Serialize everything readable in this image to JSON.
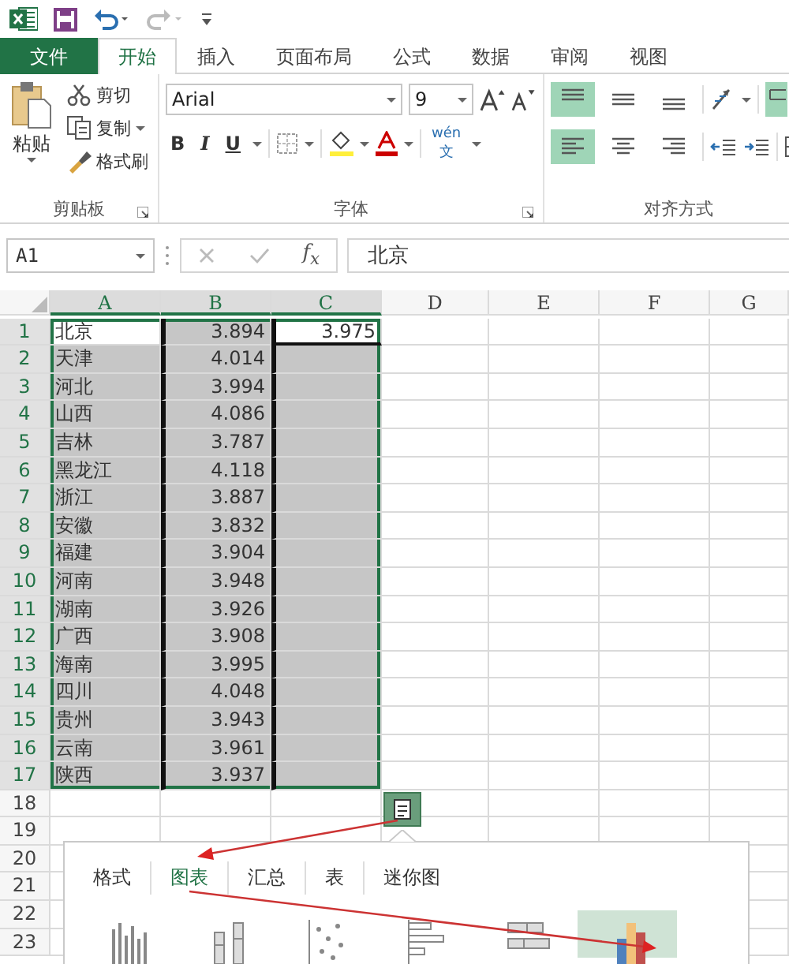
{
  "ribbon_tabs": [
    {
      "label": "文件",
      "kind": "file",
      "selected": false
    },
    {
      "label": "开始",
      "kind": "tab",
      "selected": true
    },
    {
      "label": "插入",
      "kind": "tab",
      "selected": false
    },
    {
      "label": "页面布局",
      "kind": "tab",
      "selected": false
    },
    {
      "label": "公式",
      "kind": "tab",
      "selected": false
    },
    {
      "label": "数据",
      "kind": "tab",
      "selected": false
    },
    {
      "label": "审阅",
      "kind": "tab",
      "selected": false
    },
    {
      "label": "视图",
      "kind": "tab",
      "selected": false
    }
  ],
  "clipboard": {
    "paste": "粘贴",
    "cut": "剪切",
    "copy": "复制",
    "format_painter": "格式刷",
    "group_label": "剪贴板"
  },
  "font": {
    "font_name": "Arial",
    "font_size": "9",
    "bold": "B",
    "italic": "I",
    "underline": "U",
    "phonetic": "wén",
    "phonetic_char": "文",
    "group_label": "字体"
  },
  "alignment": {
    "group_label": "对齐方式",
    "buttons": [
      {
        "kind": "top",
        "selected": true
      },
      {
        "kind": "middle",
        "selected": false
      },
      {
        "kind": "bottom",
        "selected": false
      },
      {
        "kind": "left",
        "selected": true
      },
      {
        "kind": "center",
        "selected": false
      },
      {
        "kind": "right",
        "selected": false
      }
    ]
  },
  "formula_bar": {
    "name_box": "A1",
    "fx": "f$_{x}$",
    "formula": "北京"
  },
  "columns": [
    {
      "label": "A",
      "selected": true
    },
    {
      "label": "B",
      "selected": true
    },
    {
      "label": "C",
      "selected": true
    },
    {
      "label": "D",
      "selected": false
    },
    {
      "label": "E",
      "selected": false
    },
    {
      "label": "F",
      "selected": false
    },
    {
      "label": "G",
      "selected": false
    }
  ],
  "rows": [
    {
      "number": "1",
      "selected": true,
      "cells": [
        "北京",
        "3.894",
        "3.975"
      ]
    },
    {
      "number": "2",
      "selected": true,
      "cells": [
        "天津",
        "4.014"
      ]
    },
    {
      "number": "3",
      "selected": true,
      "cells": [
        "河北",
        "3.994"
      ]
    },
    {
      "number": "4",
      "selected": true,
      "cells": [
        "山西",
        "4.086"
      ]
    },
    {
      "number": "5",
      "selected": true,
      "cells": [
        "吉林",
        "3.787"
      ]
    },
    {
      "number": "6",
      "selected": true,
      "cells": [
        "黑龙江",
        "4.118"
      ]
    },
    {
      "number": "7",
      "selected": true,
      "cells": [
        "浙江",
        "3.887"
      ]
    },
    {
      "number": "8",
      "selected": true,
      "cells": [
        "安徽",
        "3.832"
      ]
    },
    {
      "number": "9",
      "selected": true,
      "cells": [
        "福建",
        "3.904"
      ]
    },
    {
      "number": "10",
      "selected": true,
      "cells": [
        "河南",
        "3.948"
      ]
    },
    {
      "number": "11",
      "selected": true,
      "cells": [
        "湖南",
        "3.926"
      ]
    },
    {
      "number": "12",
      "selected": true,
      "cells": [
        "广西",
        "3.908"
      ]
    },
    {
      "number": "13",
      "selected": true,
      "cells": [
        "海南",
        "3.995"
      ]
    },
    {
      "number": "14",
      "selected": true,
      "cells": [
        "四川",
        "4.048"
      ]
    },
    {
      "number": "15",
      "selected": true,
      "cells": [
        "贵州",
        "3.943"
      ]
    },
    {
      "number": "16",
      "selected": true,
      "cells": [
        "云南",
        "3.961"
      ]
    },
    {
      "number": "17",
      "selected": true,
      "cells": [
        "陕西",
        "3.937"
      ]
    },
    {
      "number": "18",
      "selected": false,
      "cells": []
    },
    {
      "number": "19",
      "selected": false,
      "cells": []
    },
    {
      "number": "20",
      "selected": false,
      "cells": []
    },
    {
      "number": "21",
      "selected": false,
      "cells": []
    },
    {
      "number": "22",
      "selected": false,
      "cells": []
    },
    {
      "number": "23",
      "selected": false,
      "cells": []
    }
  ],
  "quick_analysis": {
    "tabs": [
      {
        "label": "格式",
        "selected": false
      },
      {
        "label": "图表",
        "selected": true
      },
      {
        "label": "汇总",
        "selected": false
      },
      {
        "label": "表",
        "selected": false
      },
      {
        "label": "迷你图",
        "selected": false
      }
    ],
    "charts": [
      {
        "kind": "column",
        "selected": false
      },
      {
        "kind": "stacked-column",
        "selected": false
      },
      {
        "kind": "scatter",
        "selected": false
      },
      {
        "kind": "bar",
        "selected": false
      },
      {
        "kind": "stacked-bar",
        "selected": false
      },
      {
        "kind": "more",
        "selected": true
      }
    ]
  }
}
